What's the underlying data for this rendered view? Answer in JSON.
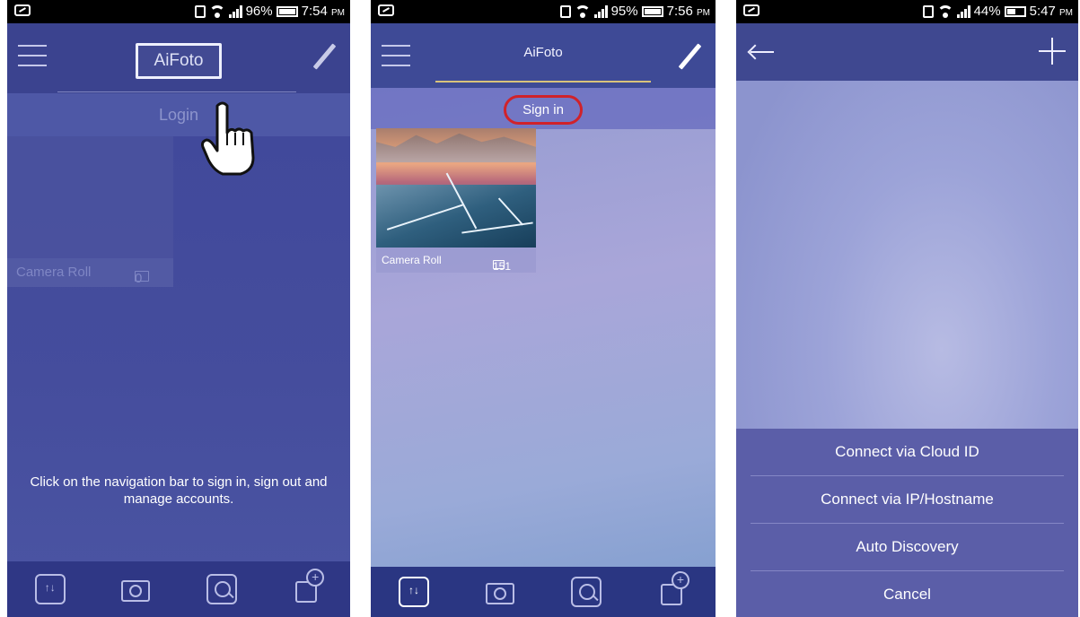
{
  "panels": [
    {
      "status": {
        "battery": "96%",
        "time": "7:54",
        "ampm": "PM"
      },
      "app_title": "AiFoto",
      "login_label": "Login",
      "album": {
        "name": "Camera Roll",
        "count": "0"
      },
      "hint": "Click on the navigation bar to sign in, sign out and manage accounts."
    },
    {
      "status": {
        "battery": "95%",
        "time": "7:56",
        "ampm": "PM"
      },
      "app_title": "AiFoto",
      "signin_label": "Sign in",
      "album": {
        "name": "Camera Roll",
        "count": "151"
      }
    },
    {
      "status": {
        "battery": "44%",
        "time": "5:47",
        "ampm": "PM"
      },
      "menu": {
        "items": [
          "Connect via Cloud ID",
          "Connect via IP/Hostname",
          "Auto Discovery",
          "Cancel"
        ]
      }
    }
  ],
  "icons": {
    "status_left": "screenshot-icon",
    "vibrate": "vibrate-icon",
    "wifi": "wifi-icon",
    "signal": "signal-icon",
    "battery": "battery-icon",
    "menu": "hamburger-icon",
    "edit": "pencil-icon",
    "back": "back-arrow-icon",
    "add": "plus-icon",
    "toolbar": [
      "sort-icon",
      "camera-icon",
      "search-icon",
      "add-folder-icon"
    ],
    "pointer": "hand-pointer-icon"
  },
  "colors": {
    "primary": "#3f479a",
    "highlight_ring": "#d0222a",
    "tab_underline": "#d9c27b",
    "sheet": "#5b5ea8"
  }
}
